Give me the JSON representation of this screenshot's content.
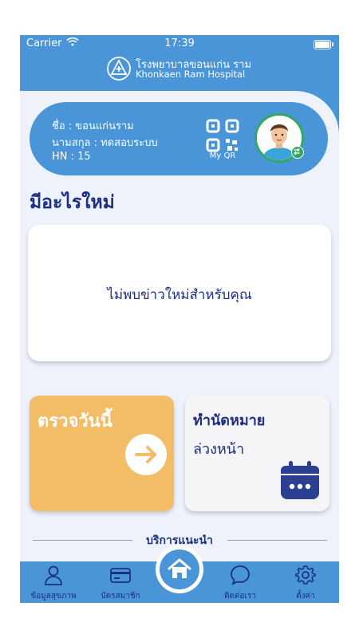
{
  "status_bar": {
    "carrier": "Carrier",
    "time": "17:39"
  },
  "header": {
    "hospital_name_th": "โรงพยาบาลขอนแก่น ราม",
    "hospital_name_en": "Khonkaen Ram Hospital"
  },
  "profile": {
    "first_name_line": "ชื่อ : ขอนแก่นราม",
    "last_name_line": "นามสกุล : ทดสอบระบบ",
    "hn_line": "HN : 15",
    "qr_label": "My QR"
  },
  "news": {
    "section_title": "มีอะไรใหม่",
    "empty_message": "ไม่พบข่าวใหม่สำหรับคุณ"
  },
  "quick_actions": {
    "today_label": "ตรวจวันนี้",
    "appointment_title": "ทำนัดหมาย",
    "appointment_subtitle": "ล่วงหน้า"
  },
  "recommended": {
    "label": "บริการแนะนำ"
  },
  "tabbar": {
    "items": [
      {
        "label": "ข้อมูลสุขภาพ",
        "icon": "person-icon"
      },
      {
        "label": "บัตรสมาชิก",
        "icon": "card-icon"
      },
      {
        "label": "",
        "icon": "home-icon"
      },
      {
        "label": "ติดต่อเรา",
        "icon": "chat-icon"
      },
      {
        "label": "ตั้งค่า",
        "icon": "gear-icon"
      }
    ]
  },
  "colors": {
    "primary": "#4a95d8",
    "navy": "#1c2f85",
    "today_card": "#f2bd66",
    "avatar_ring": "#31a860"
  }
}
